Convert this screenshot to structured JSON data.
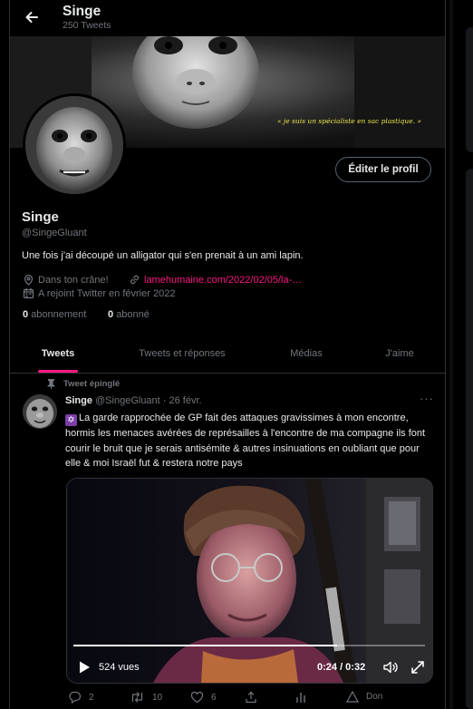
{
  "header": {
    "title": "Singe",
    "tweet_count": "250 Tweets"
  },
  "banner": {
    "caption": "« je suis un spécialiste en sac plastique. »"
  },
  "profile": {
    "edit_button": "Éditer le profil",
    "name": "Singe",
    "handle": "@SingeGluant",
    "bio": "Une fois j'ai découpé un alligator qui s'en prenait à un ami lapin.",
    "location": "Dans ton crâne!",
    "website": "lamehumaine.com/2022/02/05/la-…",
    "joined": "A rejoint Twitter en février 2022",
    "following_count": "0",
    "following_label": "abonnement",
    "followers_count": "0",
    "followers_label": "abonné"
  },
  "tabs": [
    {
      "label": "Tweets",
      "active": true
    },
    {
      "label": "Tweets et réponses",
      "active": false
    },
    {
      "label": "Médias",
      "active": false
    },
    {
      "label": "J'aime",
      "active": false
    }
  ],
  "tweet": {
    "pinned_label": "Tweet épinglé",
    "author": "Singe",
    "handle_date": "@SingeGluant · 26 févr.",
    "emoji": "✡",
    "text": "La garde rapprochée de GP fait des attaques gravissimes à mon encontre, hormis les menaces avérées de représailles à l'encontre de ma compagne ils font courir le bruit que je serais antisémite & autres insinuations en oubliant que pour elle & moi Israël fut & restera notre pays",
    "video": {
      "views": "524 vues",
      "time": "0:24 / 0:32",
      "progress": 0.75
    },
    "replies": "2",
    "retweets": "10",
    "likes": "6",
    "donate": "Don"
  },
  "colors": {
    "accent": "#f91880",
    "muted": "#71767b",
    "border": "#2f3336",
    "background": "#000000"
  },
  "icons": [
    "back-arrow-icon",
    "location-icon",
    "link-icon",
    "calendar-icon",
    "pin-icon",
    "more-icon",
    "play-icon",
    "volume-icon",
    "fullscreen-icon",
    "reply-icon",
    "retweet-icon",
    "like-icon",
    "share-icon",
    "analytics-icon",
    "donate-icon"
  ]
}
